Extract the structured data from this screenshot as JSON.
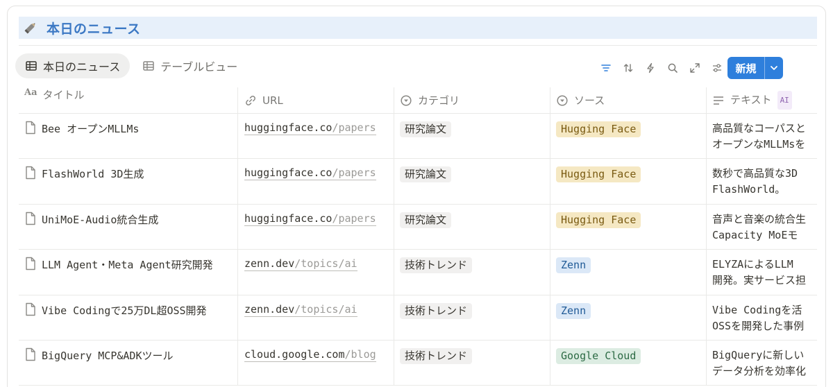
{
  "database": {
    "title": "本日のニュース"
  },
  "views": [
    {
      "label": "本日のニュース",
      "active": true
    },
    {
      "label": "テーブルビュー",
      "active": false
    }
  ],
  "toolbar": {
    "new_label": "新規"
  },
  "columns": [
    {
      "label": "タイトル",
      "icon": "text-type-icon"
    },
    {
      "label": "URL",
      "icon": "link-icon"
    },
    {
      "label": "カテゴリ",
      "icon": "select-icon"
    },
    {
      "label": "ソース",
      "icon": "select-icon"
    },
    {
      "label": "テキスト",
      "icon": "text-lines-icon",
      "badge": "AI"
    }
  ],
  "source_colors": {
    "Hugging Face": {
      "bg": "#f5e8c3",
      "fg": "#7a5b12"
    },
    "Zenn": {
      "bg": "#dbe8f7",
      "fg": "#1f5a96"
    },
    "Google Cloud": {
      "bg": "#dcece2",
      "fg": "#2c6a44"
    }
  },
  "rows": [
    {
      "title": "Bee オープンMLLMs",
      "url_host": "huggingface.co",
      "url_path": "/papers",
      "category": "研究論文",
      "source": "Hugging Face",
      "text_line1": "高品質なコーパスと",
      "text_line2": "オープンなMLLMsを"
    },
    {
      "title": "FlashWorld 3D生成",
      "url_host": "huggingface.co",
      "url_path": "/papers",
      "category": "研究論文",
      "source": "Hugging Face",
      "text_line1": "数秒で高品質な3D",
      "text_line2": "FlashWorld。"
    },
    {
      "title": "UniMoE-Audio統合生成",
      "url_host": "huggingface.co",
      "url_path": "/papers",
      "category": "研究論文",
      "source": "Hugging Face",
      "text_line1": "音声と音楽の統合生",
      "text_line2": "Capacity MoEモ"
    },
    {
      "title": "LLM Agent・Meta Agent研究開発",
      "url_host": "zenn.dev",
      "url_path": "/topics/ai",
      "category": "技術トレンド",
      "source": "Zenn",
      "text_line1": "ELYZAによるLLM",
      "text_line2": "開発。実サービス担"
    },
    {
      "title": "Vibe Codingで25万DL超OSS開発",
      "url_host": "zenn.dev",
      "url_path": "/topics/ai",
      "category": "技術トレンド",
      "source": "Zenn",
      "text_line1": "Vibe Codingを活",
      "text_line2": "OSSを開発した事例"
    },
    {
      "title": "BigQuery MCP&ADKツール",
      "url_host": "cloud.google.com",
      "url_path": "/blog",
      "category": "技術トレンド",
      "source": "Google Cloud",
      "text_line1": "BigQueryに新しい",
      "text_line2": "データ分析を効率化"
    }
  ]
}
